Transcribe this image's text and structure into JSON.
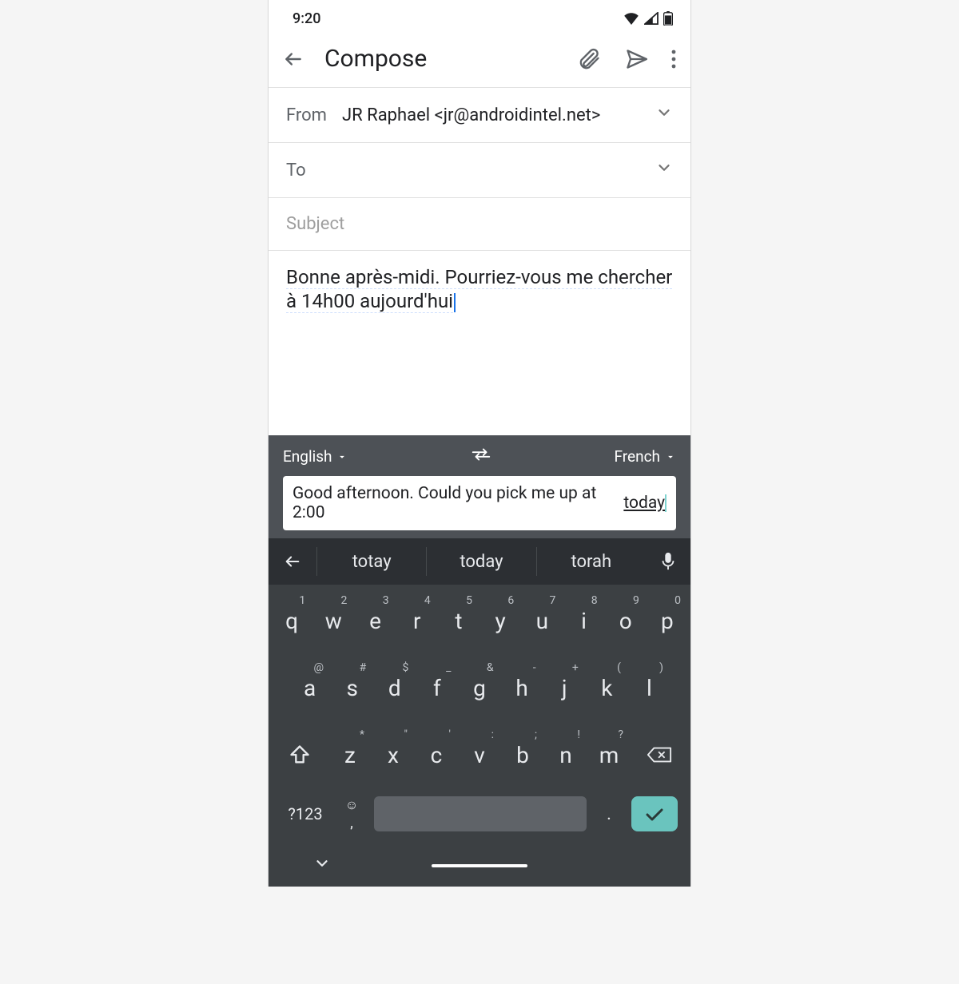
{
  "status": {
    "time": "9:20"
  },
  "appbar": {
    "title": "Compose"
  },
  "fields": {
    "from_label": "From",
    "from_value": "JR Raphael  <jr@androidintel.net>",
    "to_label": "To",
    "subject_placeholder": "Subject"
  },
  "body": {
    "text": "Bonne après-midi. Pourriez-vous me chercher à 14h00 aujourd'hui"
  },
  "translate": {
    "source_lang": "English",
    "target_lang": "French",
    "input_text": "Good afternoon. Could you pick me up at 2:00 ",
    "input_underlined": "today"
  },
  "suggestions": [
    "totay",
    "today",
    "torah"
  ],
  "keyboard": {
    "row1": [
      {
        "k": "q",
        "h": "1"
      },
      {
        "k": "w",
        "h": "2"
      },
      {
        "k": "e",
        "h": "3"
      },
      {
        "k": "r",
        "h": "4"
      },
      {
        "k": "t",
        "h": "5"
      },
      {
        "k": "y",
        "h": "6"
      },
      {
        "k": "u",
        "h": "7"
      },
      {
        "k": "i",
        "h": "8"
      },
      {
        "k": "o",
        "h": "9"
      },
      {
        "k": "p",
        "h": "0"
      }
    ],
    "row2": [
      {
        "k": "a",
        "h": "@"
      },
      {
        "k": "s",
        "h": "#"
      },
      {
        "k": "d",
        "h": "$"
      },
      {
        "k": "f",
        "h": "_"
      },
      {
        "k": "g",
        "h": "&"
      },
      {
        "k": "h",
        "h": "-"
      },
      {
        "k": "j",
        "h": "+"
      },
      {
        "k": "k",
        "h": "("
      },
      {
        "k": "l",
        "h": ")"
      }
    ],
    "row3": [
      {
        "k": "z",
        "h": "*"
      },
      {
        "k": "x",
        "h": "\""
      },
      {
        "k": "c",
        "h": "'"
      },
      {
        "k": "v",
        "h": ":"
      },
      {
        "k": "b",
        "h": ";"
      },
      {
        "k": "n",
        "h": "!"
      },
      {
        "k": "m",
        "h": "?"
      }
    ],
    "symbols_key": "?123",
    "comma_key": ",",
    "period_key": "."
  }
}
